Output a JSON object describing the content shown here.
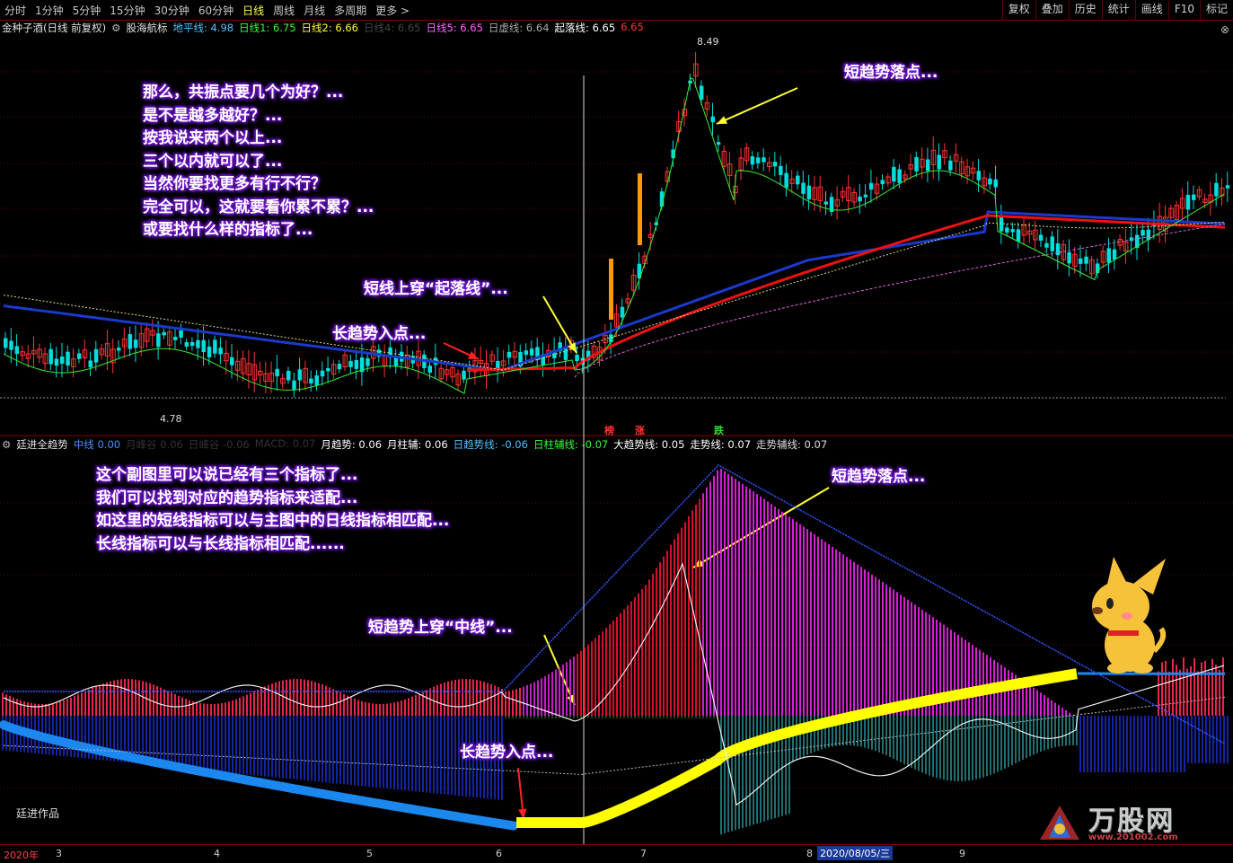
{
  "toolbar": {
    "periods": [
      "分时",
      "1分钟",
      "5分钟",
      "15分钟",
      "30分钟",
      "60分钟",
      "日线",
      "周线",
      "月线",
      "多周期",
      "更多 >"
    ],
    "active_period": "日线",
    "buttons": [
      "复权",
      "叠加",
      "历史",
      "统计",
      "画线",
      "F10",
      "标记"
    ]
  },
  "main_legend": {
    "title": "金种子酒(日线 前复权)",
    "indicator": "股海航标",
    "items": [
      {
        "label": "地平线: 4.98",
        "color": "#4ec3ff"
      },
      {
        "label": "日线1: 6.75",
        "color": "#33ff33"
      },
      {
        "label": "日线2: 6.66",
        "color": "#ffff33"
      },
      {
        "label": "日线4: 6.65",
        "color": "#444444"
      },
      {
        "label": "日线5: 6.65",
        "color": "#ff66ff"
      },
      {
        "label": "日虚线: 6.64",
        "color": "#aaaaaa"
      },
      {
        "label": "起落线: 6.65",
        "color": "#ffffff"
      },
      {
        "label": "6.65",
        "color": "#ff3333"
      }
    ]
  },
  "sub_legend": {
    "title": "廷进全趋势",
    "items": [
      {
        "label": "中线 0.00",
        "color": "#4e8cff"
      },
      {
        "label": "月峰谷 0.06",
        "color": "#333333"
      },
      {
        "label": "日峰谷 -0.06",
        "color": "#333333"
      },
      {
        "label": "MACD: 0.07",
        "color": "#333333"
      },
      {
        "label": "月趋势: 0.06",
        "color": "#ffffff"
      },
      {
        "label": "月柱辅: 0.06",
        "color": "#ffffff"
      },
      {
        "label": "日趋势线: -0.06",
        "color": "#4ec3ff"
      },
      {
        "label": "日柱辅线: -0.07",
        "color": "#33ff33"
      },
      {
        "label": "大趋势线: 0.05",
        "color": "#ffffff"
      },
      {
        "label": "走势线: 0.07",
        "color": "#ffffff"
      },
      {
        "label": "走势辅线: 0.07",
        "color": "#dddddd"
      }
    ]
  },
  "price_labels": {
    "high": "8.49",
    "low": "4.78"
  },
  "signals": [
    {
      "label": "榜",
      "color": "#ff3333"
    },
    {
      "label": "涨",
      "color": "#ff3333"
    },
    {
      "label": "跌",
      "color": "#33dd33"
    }
  ],
  "notes": {
    "main_block": [
      "那么，共振点要几个为好？...",
      "是不是越多越好？...",
      "按我说来两个以上...",
      "三个以内就可以了...",
      "当然你要找更多有行不行？",
      "完全可以，这就要看你累不累？...",
      "或要找什么样的指标了..."
    ],
    "main_short_drop": "短趋势落点...",
    "main_cross": "短线上穿“起落线”...",
    "main_long_entry": "长趋势入点...",
    "sub_block": [
      "这个副图里可以说已经有三个指标了...",
      "我们可以找到对应的趋势指标来适配...",
      "如这里的短线指标可以与主图中的日线指标相匹配...",
      "长线指标可以与长线指标相匹配......"
    ],
    "sub_short_drop": "短趋势落点...",
    "sub_cross": "短趋势上穿“中线”...",
    "sub_long_entry": "长趋势入点..."
  },
  "xaxis": {
    "labels": [
      "2020年",
      "3",
      "4",
      "5",
      "6",
      "7",
      "8",
      "2020/08/05/三",
      "9"
    ]
  },
  "author": "廷进作品",
  "watermark": {
    "name": "万股网",
    "url": "www.201002.com"
  }
}
